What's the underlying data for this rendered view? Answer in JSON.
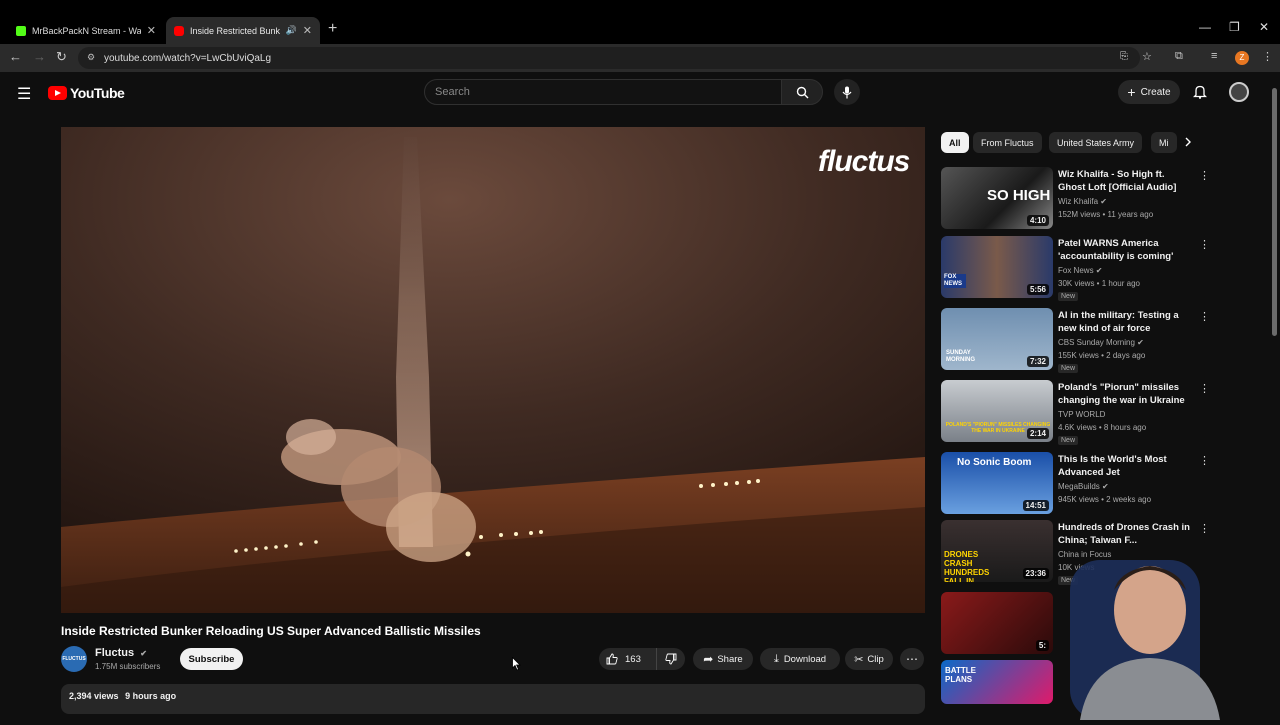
{
  "browser": {
    "tabs": [
      {
        "title": "MrBackPackN Stream - Watch Liv"
      },
      {
        "title": "Inside Restricted Bunker Rel"
      }
    ],
    "url": "youtube.com/watch?v=LwCbUviQaLg",
    "profile_initial": "Z"
  },
  "header": {
    "logo_text": "YouTube",
    "search_placeholder": "Search",
    "create_label": "Create"
  },
  "video": {
    "watermark": "fluctus",
    "title": "Inside Restricted Bunker Reloading US Super Advanced Ballistic Missiles",
    "channel": "Fluctus",
    "channel_avatar_text": "FLUCTUS",
    "subscribers": "1.75M subscribers",
    "subscribe_label": "Subscribe",
    "likes": "163",
    "share_label": "Share",
    "download_label": "Download",
    "clip_label": "Clip",
    "views": "2,394 views",
    "age": "9 hours ago"
  },
  "chips": [
    "All",
    "From Fluctus",
    "United States Army",
    "Mi"
  ],
  "recommendations": [
    {
      "title": "Wiz Khalifa - So High ft. Ghost Loft [Official Audio]",
      "channel": "Wiz Khalifa",
      "meta": "152M views • 11 years ago",
      "duration": "4:10",
      "thumb_text": "SO HIGH",
      "badge": ""
    },
    {
      "title": "Patel WARNS America 'accountability is coming'",
      "channel": "Fox News",
      "meta": "30K views • 1 hour ago",
      "duration": "5:56",
      "thumb_text": "FOX NEWS",
      "badge": "New"
    },
    {
      "title": "AI in the military: Testing a new kind of air force",
      "channel": "CBS Sunday Morning",
      "meta": "155K views • 2 days ago",
      "duration": "7:32",
      "thumb_text": "SUNDAY MORNING",
      "badge": "New"
    },
    {
      "title": "Poland's \"Piorun\" missiles changing the war in Ukraine",
      "channel": "TVP WORLD",
      "meta": "4.6K views • 8 hours ago",
      "duration": "2:14",
      "thumb_text": "POLAND'S \"PIORUN\" MISSILES CHANGING THE WAR IN UKRAINE",
      "badge": "New"
    },
    {
      "title": "This Is the World's Most Advanced Jet",
      "channel": "MegaBuilds",
      "meta": "945K views • 2 weeks ago",
      "duration": "14:51",
      "thumb_text": "No Sonic Boom",
      "badge": ""
    },
    {
      "title": "Hundreds of Drones Crash in China; Taiwan F...",
      "channel": "China in Focus",
      "meta": "10K views",
      "duration": "23:36",
      "thumb_text": "DRONES CRASH HUNDREDS FALL IN FLAMES",
      "badge": "New"
    },
    {
      "title": "",
      "channel": "",
      "meta": "",
      "duration": "5:",
      "thumb_text": "",
      "badge": ""
    },
    {
      "title": "",
      "channel": "",
      "meta": "",
      "duration": "",
      "thumb_text": "BATTLE PLANS",
      "badge": ""
    }
  ],
  "colors": {
    "accent": "#ff0000",
    "background": "#0f0f0f",
    "surface": "#272727"
  }
}
